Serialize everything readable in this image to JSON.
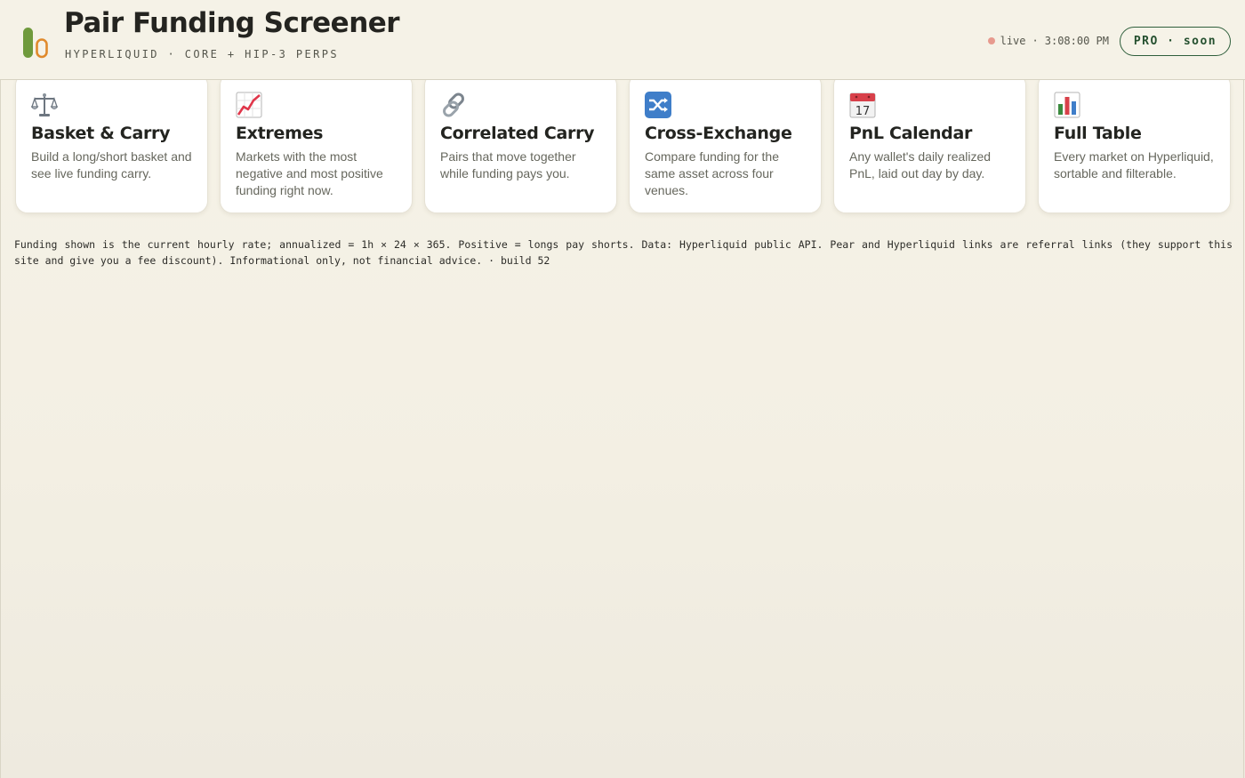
{
  "header": {
    "title": "Pair Funding Screener",
    "subtitle": "HYPERLIQUID · CORE + HIP-3 PERPS",
    "logo_icon": "pill-capsules-logo",
    "status": {
      "label": "live",
      "separator": "·",
      "time": "3:08:00 PM",
      "dot_color": "#e79a8e"
    },
    "pro_button": "PRO · soon"
  },
  "cards": [
    {
      "icon": "scales-icon",
      "title": "Basket & Carry",
      "description": "Build a long/short basket and see live funding carry."
    },
    {
      "icon": "chart-increasing-icon",
      "title": "Extremes",
      "description": "Markets with the most negative and most positive funding right now."
    },
    {
      "icon": "link-icon",
      "title": "Correlated Carry",
      "description": "Pairs that move together while funding pays you."
    },
    {
      "icon": "shuffle-icon",
      "title": "Cross-Exchange",
      "description": "Compare funding for the same asset across four venues."
    },
    {
      "icon": "calendar-icon",
      "title": "PnL Calendar",
      "description": "Any wallet's daily realized PnL, laid out day by day."
    },
    {
      "icon": "bar-chart-icon",
      "title": "Full Table",
      "description": "Every market on Hyperliquid, sortable and filterable."
    }
  ],
  "calendar_day": "17",
  "footer_note": "Funding shown is the current hourly rate; annualized = 1h × 24 × 365. Positive = longs pay shorts. Data: Hyperliquid public API. Pear and Hyperliquid links are referral links (they support this site and give you a fee discount). Informational only, not financial advice. · build 52",
  "colors": {
    "accent_green": "#2f5f3c",
    "background": "#f5f2e7",
    "logo_green": "#6f9a3c",
    "logo_orange": "#e08a2c"
  }
}
